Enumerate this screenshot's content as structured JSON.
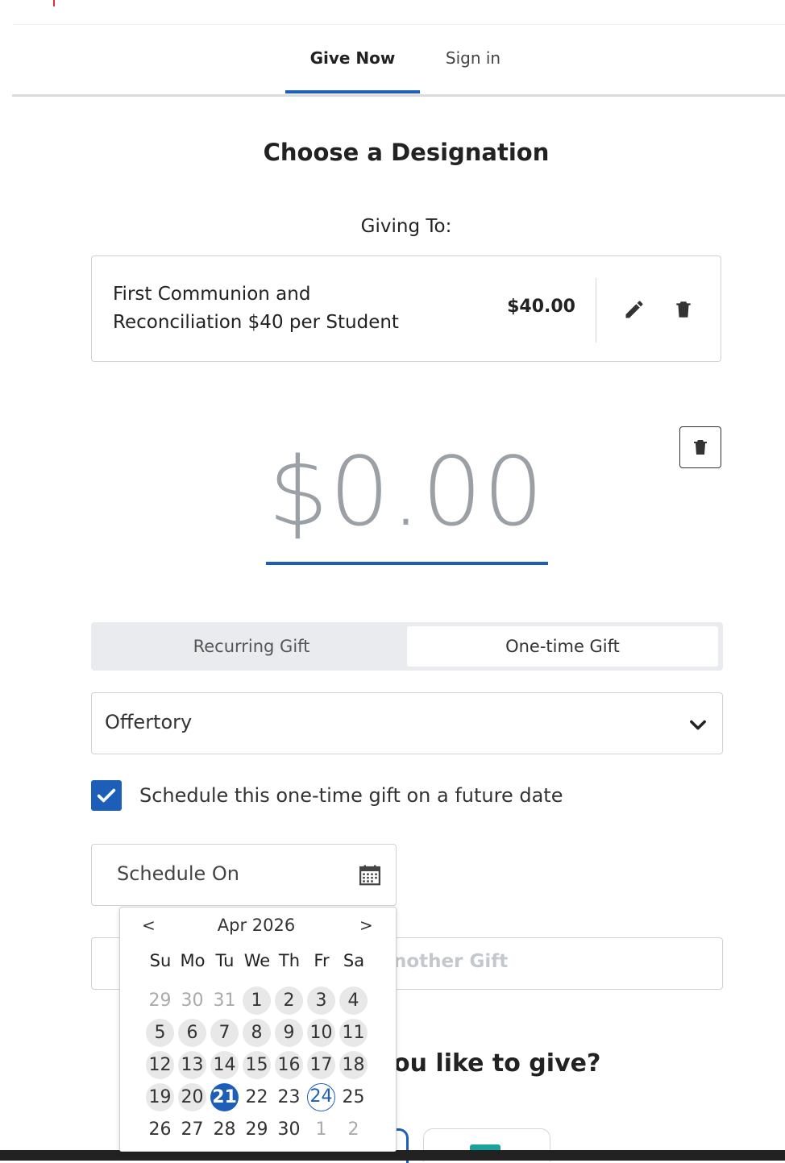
{
  "nav": {
    "tabs": [
      {
        "label": "Give Now",
        "active": true
      },
      {
        "label": "Sign in",
        "active": false
      }
    ]
  },
  "designation": {
    "heading": "Choose a Designation",
    "giving_to_label": "Giving To:",
    "item": {
      "name_line1": "First Communion and",
      "name_line2": "Reconciliation $40 per Student",
      "amount": "$40.00",
      "edit_icon": "pencil-icon",
      "delete_icon": "trash-icon"
    }
  },
  "gift": {
    "amount": "$0.00",
    "frequency_options": [
      "Recurring Gift",
      "One-time Gift"
    ],
    "frequency_selected": "One-time Gift",
    "fund_selected": "Offertory",
    "schedule_checkbox_label": "Schedule this one-time gift on a future date",
    "schedule_checked": true,
    "schedule_placeholder": "Schedule On",
    "add_another_label": "nother Gift",
    "payment_question": "ou like to give?"
  },
  "calendar": {
    "prev_label": "<",
    "next_label": ">",
    "month_label": "Apr 2026",
    "weekdays": [
      "Su",
      "Mo",
      "Tu",
      "We",
      "Th",
      "Fr",
      "Sa"
    ],
    "weeks": [
      [
        {
          "d": "29",
          "s": "muted"
        },
        {
          "d": "30",
          "s": "muted"
        },
        {
          "d": "31",
          "s": "muted"
        },
        {
          "d": "1",
          "s": "in"
        },
        {
          "d": "2",
          "s": "in"
        },
        {
          "d": "3",
          "s": "in"
        },
        {
          "d": "4",
          "s": "in"
        }
      ],
      [
        {
          "d": "5",
          "s": "in"
        },
        {
          "d": "6",
          "s": "in"
        },
        {
          "d": "7",
          "s": "in"
        },
        {
          "d": "8",
          "s": "in"
        },
        {
          "d": "9",
          "s": "in"
        },
        {
          "d": "10",
          "s": "in"
        },
        {
          "d": "11",
          "s": "in"
        }
      ],
      [
        {
          "d": "12",
          "s": "in"
        },
        {
          "d": "13",
          "s": "in"
        },
        {
          "d": "14",
          "s": "in"
        },
        {
          "d": "15",
          "s": "in"
        },
        {
          "d": "16",
          "s": "in"
        },
        {
          "d": "17",
          "s": "in"
        },
        {
          "d": "18",
          "s": "in"
        }
      ],
      [
        {
          "d": "19",
          "s": "in"
        },
        {
          "d": "20",
          "s": "in"
        },
        {
          "d": "21",
          "s": "sel"
        },
        {
          "d": "22",
          "s": "plain"
        },
        {
          "d": "23",
          "s": "plain"
        },
        {
          "d": "24",
          "s": "today"
        },
        {
          "d": "25",
          "s": "plain"
        }
      ],
      [
        {
          "d": "26",
          "s": "plain"
        },
        {
          "d": "27",
          "s": "plain"
        },
        {
          "d": "28",
          "s": "plain"
        },
        {
          "d": "29",
          "s": "plain"
        },
        {
          "d": "30",
          "s": "plain"
        },
        {
          "d": "1",
          "s": "muted"
        },
        {
          "d": "2",
          "s": "muted"
        }
      ]
    ]
  },
  "colors": {
    "accent": "#1d5fb8",
    "placeholder_amount": "#9aa0a5",
    "border": "#cfd3d8"
  }
}
